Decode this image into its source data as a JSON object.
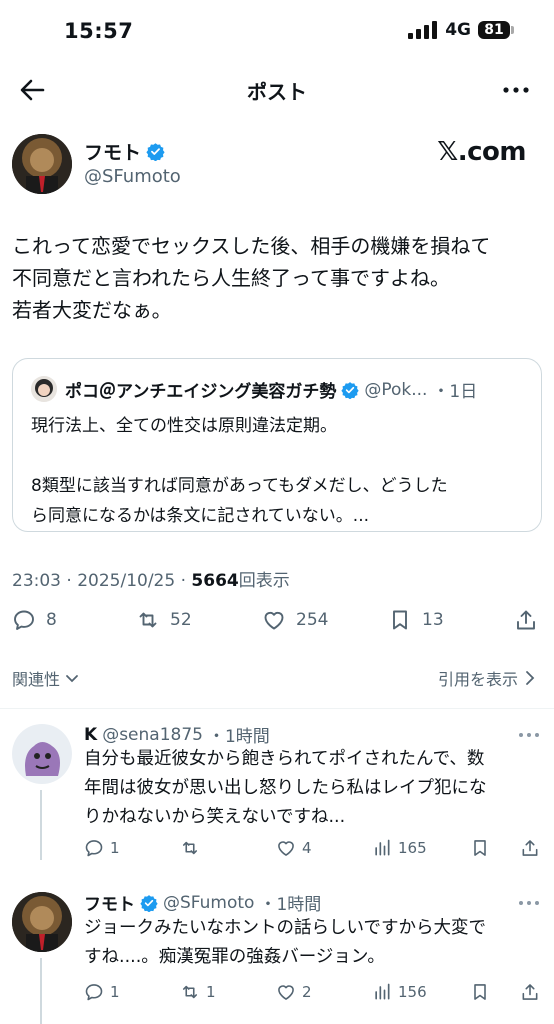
{
  "status_bar": {
    "time": "15:57",
    "network": "4G",
    "battery": "81"
  },
  "nav": {
    "title": "ポスト"
  },
  "post": {
    "author_name": "フモト",
    "author_handle": "@SFumoto",
    "brand": "𝕏.com",
    "body_lines": [
      "これって恋愛でセックスした後、相手の機嫌を損ねて",
      "不同意だと言われたら人生終了って事ですよね。",
      "若者大変だなぁ。"
    ],
    "quote": {
      "name": "ポコ＠アンチエイジング美容ガチ勢",
      "handle": "@Pok...",
      "time": "・1日",
      "lines": [
        "現行法上、全ての性交は原則違法定期。",
        "",
        "8類型に該当すれば同意があってもダメだし、どうした",
        "ら同意になるかは条文に記されていない。..."
      ]
    },
    "time": "23:03 · 2025/10/25 · ",
    "views": "5664",
    "views_label": "回表示",
    "stats": {
      "replies": "8",
      "reposts": "52",
      "likes": "254",
      "bookmarks": "13"
    },
    "relevance_label": "関連性",
    "quotes_label": "引用を表示"
  },
  "replies": [
    {
      "name": "K",
      "handle": "@sena1875",
      "time": "・1時間",
      "lines": [
        "自分も最近彼女から飽きられてポイされたんで、数",
        "年間は彼女が思い出し怒りしたら私はレイプ犯にな",
        "りかねないから笑えないですね..."
      ],
      "stats": {
        "replies": "1",
        "reposts": "",
        "likes": "4",
        "views": "165"
      }
    },
    {
      "name": "フモト",
      "handle": "@SFumoto",
      "time": "・1時間",
      "lines": [
        "ジョークみたいなホントの話らしいですから大変で",
        "すね....。痴漢冤罪の強姦バージョン。"
      ],
      "stats": {
        "replies": "1",
        "reposts": "1",
        "likes": "2",
        "views": "156"
      }
    }
  ],
  "colors": {
    "text": "#0f1419",
    "muted": "#536471",
    "verified": "#1d9bf0",
    "border": "#cfd9de"
  }
}
